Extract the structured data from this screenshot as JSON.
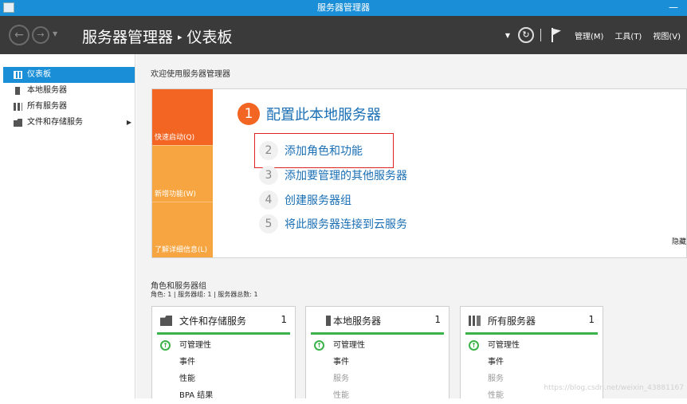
{
  "window": {
    "title": "服务器管理器",
    "minimize": "—"
  },
  "header": {
    "breadcrumb_root": "服务器管理器",
    "breadcrumb_sep": "▸",
    "breadcrumb_current": "仪表板",
    "menu": [
      "管理(M)",
      "工具(T)",
      "视图(V)"
    ]
  },
  "sidebar": {
    "items": [
      {
        "label": "仪表板",
        "icon": "dashboard-icon"
      },
      {
        "label": "本地服务器",
        "icon": "local-server-icon"
      },
      {
        "label": "所有服务器",
        "icon": "all-servers-icon"
      },
      {
        "label": "文件和存储服务",
        "icon": "file-storage-icon"
      }
    ]
  },
  "main": {
    "welcome": "欢迎使用服务器管理器",
    "quick_start": {
      "strips": [
        "快速启动(Q)",
        "新增功能(W)",
        "了解详细信息(L)"
      ],
      "main_step": {
        "number": "1",
        "label": "配置此本地服务器"
      },
      "steps": [
        {
          "number": "2",
          "label": "添加角色和功能"
        },
        {
          "number": "3",
          "label": "添加要管理的其他服务器"
        },
        {
          "number": "4",
          "label": "创建服务器组"
        },
        {
          "number": "5",
          "label": "将此服务器连接到云服务"
        }
      ],
      "hide": "隐藏"
    },
    "roles": {
      "title": "角色和服务器组",
      "summary": "角色: 1 | 服务器组: 1 | 服务器总数: 1",
      "cards": [
        {
          "title": "文件和存储服务",
          "count": "1",
          "rows": [
            "可管理性",
            "事件",
            "性能",
            "BPA 结果"
          ]
        },
        {
          "title": "本地服务器",
          "count": "1",
          "rows": [
            "可管理性",
            "事件",
            "服务",
            "性能"
          ]
        },
        {
          "title": "所有服务器",
          "count": "1",
          "rows": [
            "可管理性",
            "事件",
            "服务",
            "性能"
          ]
        }
      ]
    },
    "watermark": "https://blog.csdn.net/weixin_43881167"
  },
  "colors": {
    "accent": "#1a8fd8",
    "orange": "#f26522",
    "light_orange": "#f7a540",
    "link": "#1a6fb4",
    "status_green": "#3cb34a"
  }
}
